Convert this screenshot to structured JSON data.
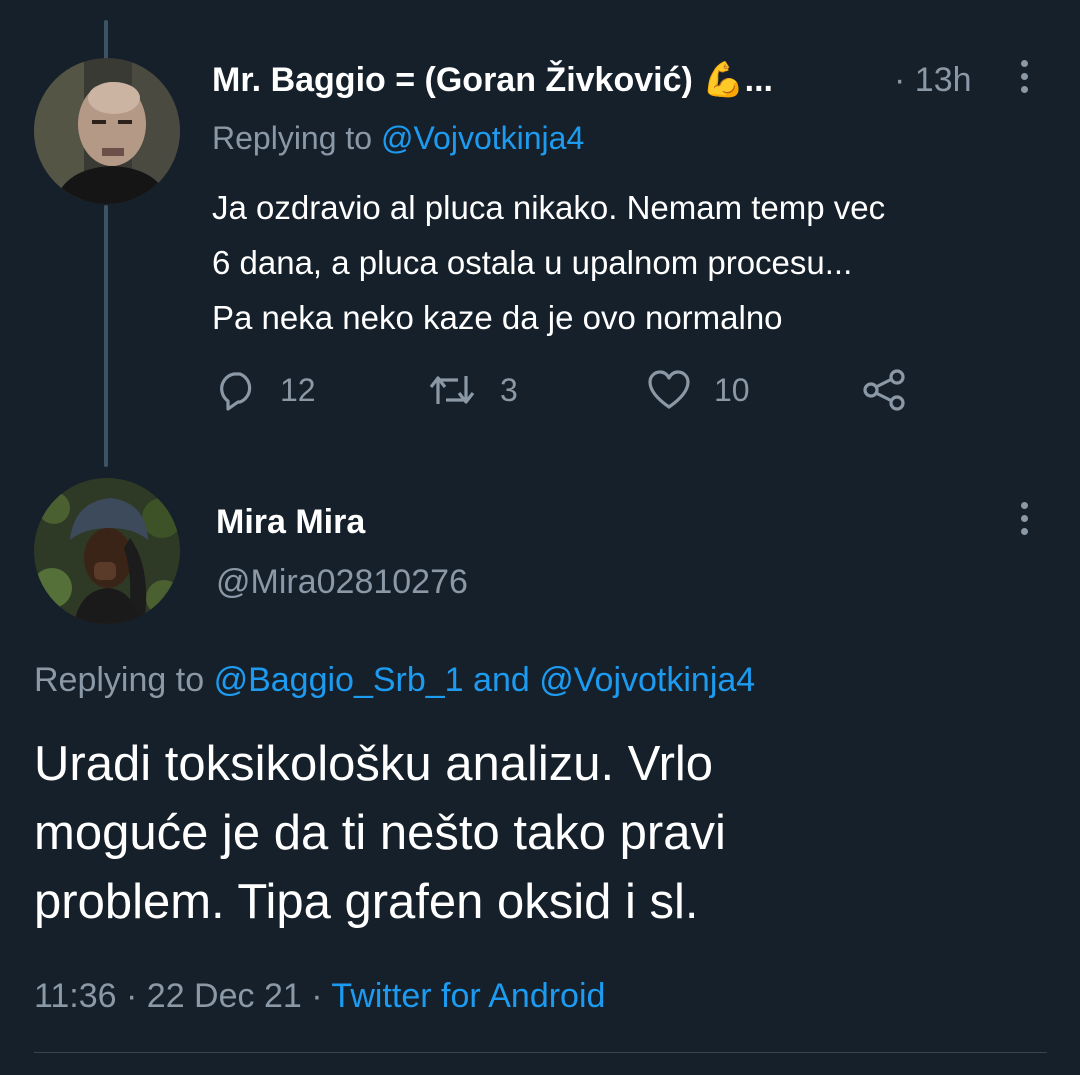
{
  "parent_tweet": {
    "display_name": "Mr. Baggio = (Goran Živković)",
    "name_emoji": "💪",
    "name_ellipsis": "...",
    "separator": "·",
    "time_ago": "13h",
    "replying_prefix": "Replying to",
    "replying_to": "@Vojvotkinja4",
    "text_lines": [
      "Ja ozdravio al pluca nikako. Nemam temp vec",
      "6 dana, a pluca ostala u upalnom procesu...",
      "Pa neka neko kaze da je ovo normalno"
    ],
    "actions": {
      "reply_count": "12",
      "retweet_count": "3",
      "like_count": "10"
    },
    "icons": [
      "reply-icon",
      "retweet-icon",
      "like-icon",
      "share-icon",
      "more-icon"
    ]
  },
  "main_tweet": {
    "display_name": "Mira Mira",
    "handle": "@Mira02810276",
    "replying_prefix": "Replying to",
    "replying_to_1": "@Baggio_Srb_1",
    "replying_and": "and",
    "replying_to_2": "@Vojvotkinja4",
    "text_lines": [
      "Uradi toksikološku analizu. Vrlo",
      "moguće je da ti nešto tako pravi",
      "problem. Tipa grafen oksid i sl."
    ],
    "time": "11:36",
    "date": "22 Dec 21",
    "separator": "·",
    "source": "Twitter for Android"
  },
  "colors": {
    "background": "#15202b",
    "text": "#ffffff",
    "muted": "#8b98a5",
    "accent": "#1d9bf0",
    "thread_line": "#3d5466",
    "divider": "#38444d"
  }
}
